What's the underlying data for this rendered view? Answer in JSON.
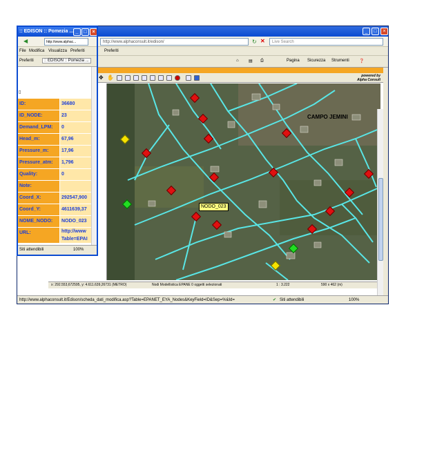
{
  "main_window": {
    "address": "http://www.alphaconsult.it/edison/",
    "live_search": "Live Search",
    "menu": [
      "File",
      "Modifica",
      "Visualizza",
      "Preferiti"
    ],
    "toolbar": [
      "Pagina",
      "Sicurezza",
      "Strumenti"
    ],
    "status_url": "http://www.alphaconsult.it/Edison/scheda_dati_modifica.asp?Table=EPANET_EYA_Nodes&KeyField=ID&Sep=%&Id=",
    "status_zone": "Siti attendibili",
    "zoom": "100%"
  },
  "map": {
    "powered_line1": "powered by",
    "powered_line2": "Alpha Consult",
    "street_label": "CAMPO JEMINI",
    "selected_node": "NODO_023",
    "status_coords": "x: 292.553,672595, y: 4.611.639,26731 (METRO)",
    "status_layer": "Nodi Modellistica EPANE  0 oggetti selezionati",
    "status_scale": "1 : 3.222",
    "status_size": "590 x 462 (m)"
  },
  "popup": {
    "title": ":: EDISON :: Pomezia ...",
    "address": "http://www.alphac...",
    "menu": [
      "File",
      "Modifica",
      "Visualizza",
      "Preferiti"
    ],
    "tab_fav": "Preferiti",
    "tab_label": ":: EDISON :: Pomezia ...",
    "status_zone": "Siti attendibili",
    "zoom": "100%",
    "fields": [
      {
        "label": "ID:",
        "value": "36680"
      },
      {
        "label": "ID_NODE:",
        "value": "23"
      },
      {
        "label": "Demand_LPM:",
        "value": "0"
      },
      {
        "label": "Head_m:",
        "value": "67,96"
      },
      {
        "label": "Pressure_m:",
        "value": "17,96"
      },
      {
        "label": "Pressure_atm:",
        "value": "1,796"
      },
      {
        "label": "Quality:",
        "value": "0"
      },
      {
        "label": "Note:",
        "value": ""
      },
      {
        "label": "Coord_X:",
        "value": "292547,900"
      },
      {
        "label": "Coord_Y:",
        "value": "4611639,37"
      },
      {
        "label": "NOME_NODO:",
        "value": "NODO_023"
      },
      {
        "label": "URL:",
        "value": "http://www"
      },
      {
        "label": "",
        "value": "Table=EPAI"
      }
    ]
  }
}
